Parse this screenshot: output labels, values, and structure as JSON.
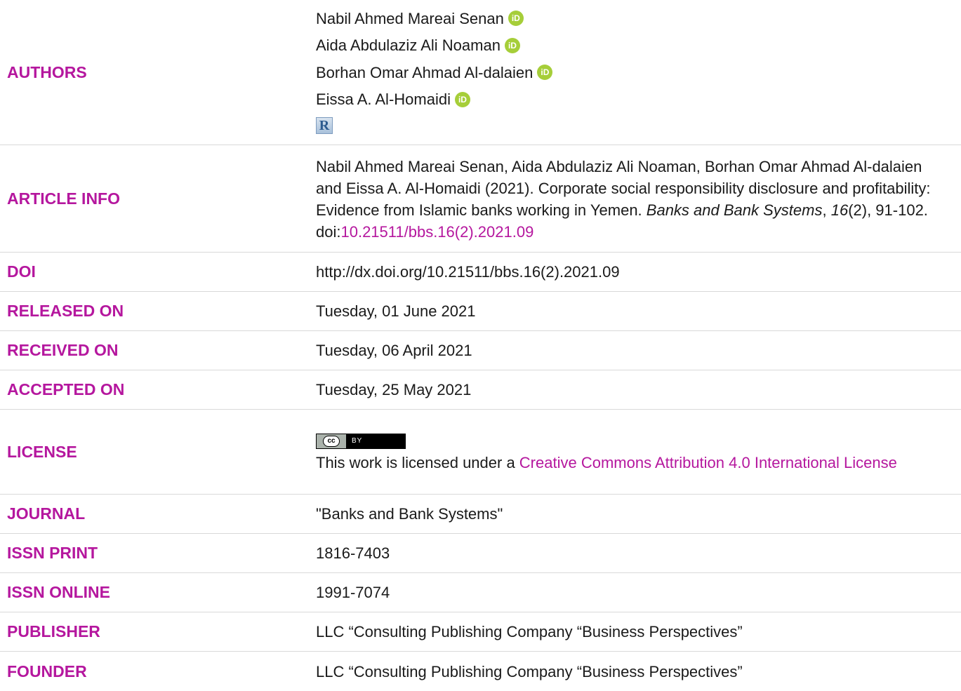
{
  "authors": {
    "label": "AUTHORS",
    "names": [
      "Nabil Ahmed Mareai Senan",
      "Aida Abdulaziz Ali Noaman",
      "Borhan Omar Ahmad Al-dalaien",
      "Eissa A. Al-Homaidi"
    ]
  },
  "article_info": {
    "label": "ARTICLE INFO",
    "citation_prefix": "Nabil Ahmed Mareai Senan, Aida Abdulaziz Ali Noaman, Borhan Omar Ahmad Al-dalaien and Eissa A. Al-Homaidi (2021). Corporate social responsibility disclosure and profitability: Evidence from Islamic banks working in Yemen. ",
    "journal_italic": "Banks and Bank Systems",
    "sep1": ", ",
    "volume_italic": "16",
    "issue_pages": "(2), 91-102. doi:",
    "doi_link": "10.21511/bbs.16(2).2021.09"
  },
  "rows": {
    "doi": {
      "label": "DOI",
      "value": "http://dx.doi.org/10.21511/bbs.16(2).2021.09"
    },
    "released": {
      "label": "RELEASED ON",
      "value": "Tuesday, 01 June 2021"
    },
    "received": {
      "label": "RECEIVED ON",
      "value": "Tuesday, 06 April 2021"
    },
    "accepted": {
      "label": "ACCEPTED ON",
      "value": "Tuesday, 25 May 2021"
    }
  },
  "license": {
    "label": "LICENSE",
    "badge_left": "cc",
    "badge_right": "BY",
    "text_prefix": "This work is licensed under a ",
    "link_text": "Creative Commons Attribution 4.0 International License"
  },
  "rows2": {
    "journal": {
      "label": "JOURNAL",
      "value": "\"Banks and Bank Systems\""
    },
    "issn_print": {
      "label": "ISSN PRINT",
      "value": "1816-7403"
    },
    "issn_online": {
      "label": "ISSN ONLINE",
      "value": "1991-7074"
    },
    "publisher": {
      "label": "PUBLISHER",
      "value": "LLC “Consulting Publishing Company “Business Perspectives”"
    },
    "founder": {
      "label": "FOUNDER",
      "value": "LLC “Consulting Publishing Company “Business Perspectives”"
    }
  },
  "colors": {
    "label": "#b5179e",
    "orcid": "#a6ce39",
    "divider": "#d9d9d9"
  }
}
